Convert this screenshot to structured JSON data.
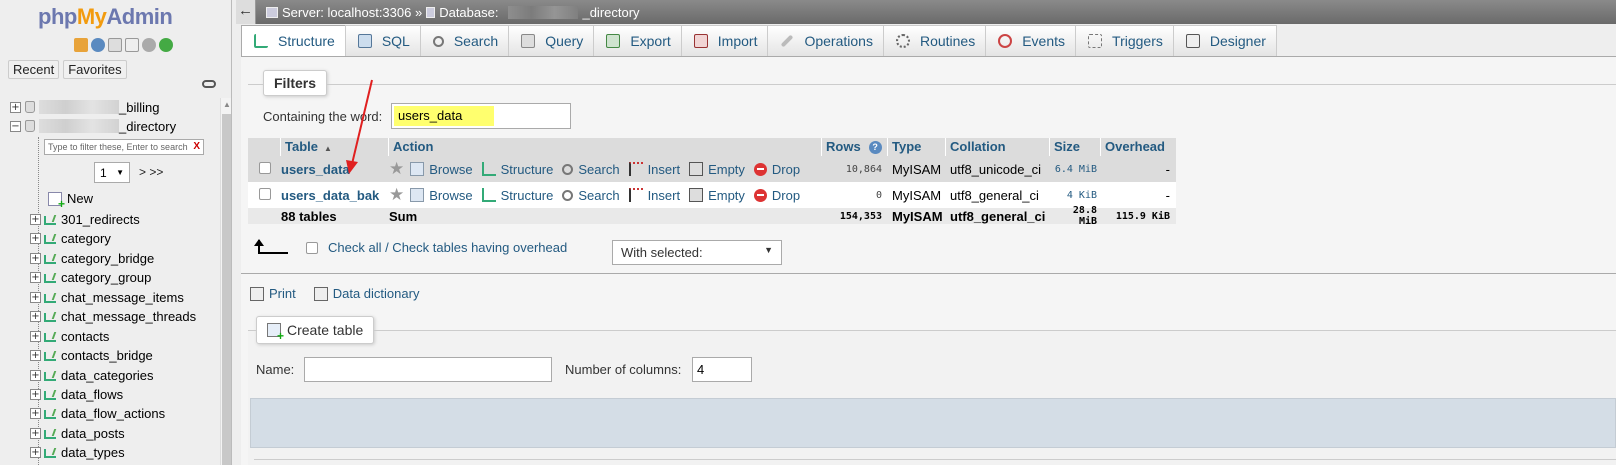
{
  "nav": {
    "logo": {
      "php": "php",
      "my": "My",
      "admin": "Admin"
    },
    "icons": [
      "home-icon",
      "help-icon",
      "docs-icon",
      "copy-icon",
      "settings-icon",
      "reload-icon"
    ],
    "recent_label": "Recent",
    "favorites_label": "Favorites",
    "databases": [
      {
        "suffix": "_billing",
        "expanded": false
      },
      {
        "suffix": "_directory",
        "expanded": true
      }
    ],
    "filter_placeholder": "Type to filter these, Enter to search",
    "filter_clear": "X",
    "page_value": "1",
    "page_next": "> >>",
    "new_label": "New",
    "tables": [
      "301_redirects",
      "category",
      "category_bridge",
      "category_group",
      "chat_message_items",
      "chat_message_threads",
      "contacts",
      "contacts_bridge",
      "data_categories",
      "data_flows",
      "data_flow_actions",
      "data_posts",
      "data_types"
    ]
  },
  "topbar": {
    "back": "←",
    "server": "Server: localhost:3306 »",
    "database_prefix": "Database:",
    "database_suffix": "_directory"
  },
  "tabs": [
    {
      "label": "Structure",
      "icon": "structure-icon",
      "active": true
    },
    {
      "label": "SQL",
      "icon": "sql-icon"
    },
    {
      "label": "Search",
      "icon": "search-icon"
    },
    {
      "label": "Query",
      "icon": "query-icon"
    },
    {
      "label": "Export",
      "icon": "export-icon"
    },
    {
      "label": "Import",
      "icon": "import-icon"
    },
    {
      "label": "Operations",
      "icon": "operations-icon"
    },
    {
      "label": "Routines",
      "icon": "routines-icon"
    },
    {
      "label": "Events",
      "icon": "events-icon"
    },
    {
      "label": "Triggers",
      "icon": "triggers-icon"
    },
    {
      "label": "Designer",
      "icon": "designer-icon"
    }
  ],
  "filters": {
    "legend": "Filters",
    "label": "Containing the word:",
    "value": "users_data"
  },
  "table": {
    "headers": {
      "table": "Table",
      "action": "Action",
      "rows": "Rows",
      "type": "Type",
      "collation": "Collation",
      "size": "Size",
      "overhead": "Overhead"
    },
    "action_labels": {
      "browse": "Browse",
      "structure": "Structure",
      "search": "Search",
      "insert": "Insert",
      "empty": "Empty",
      "drop": "Drop"
    },
    "rows": [
      {
        "name": "users_data",
        "rows": "10,864",
        "type": "MyISAM",
        "collation": "utf8_unicode_ci",
        "size": "6.4 MiB",
        "overhead": "-"
      },
      {
        "name": "users_data_bak",
        "rows": "0",
        "type": "MyISAM",
        "collation": "utf8_general_ci",
        "size": "4 KiB",
        "overhead": "-"
      }
    ],
    "summary": {
      "name": "88 tables",
      "label": "Sum",
      "rows": "154,353",
      "type": "MyISAM",
      "collation": "utf8_general_ci",
      "size": "28.8 MiB",
      "overhead": "115.9 KiB"
    }
  },
  "bulk": {
    "check_all": "Check all / Check tables having overhead",
    "with_selected": "With selected:"
  },
  "links": {
    "print": "Print",
    "data_dictionary": "Data dictionary"
  },
  "create": {
    "legend": "Create table",
    "name_label": "Name:",
    "name_value": "",
    "columns_label": "Number of columns:",
    "columns_value": "4"
  },
  "colors": {
    "link": "#235a81",
    "highlight": "#ffff6e",
    "drop": "#dd3333",
    "annotation_arrow": "#e02020"
  }
}
